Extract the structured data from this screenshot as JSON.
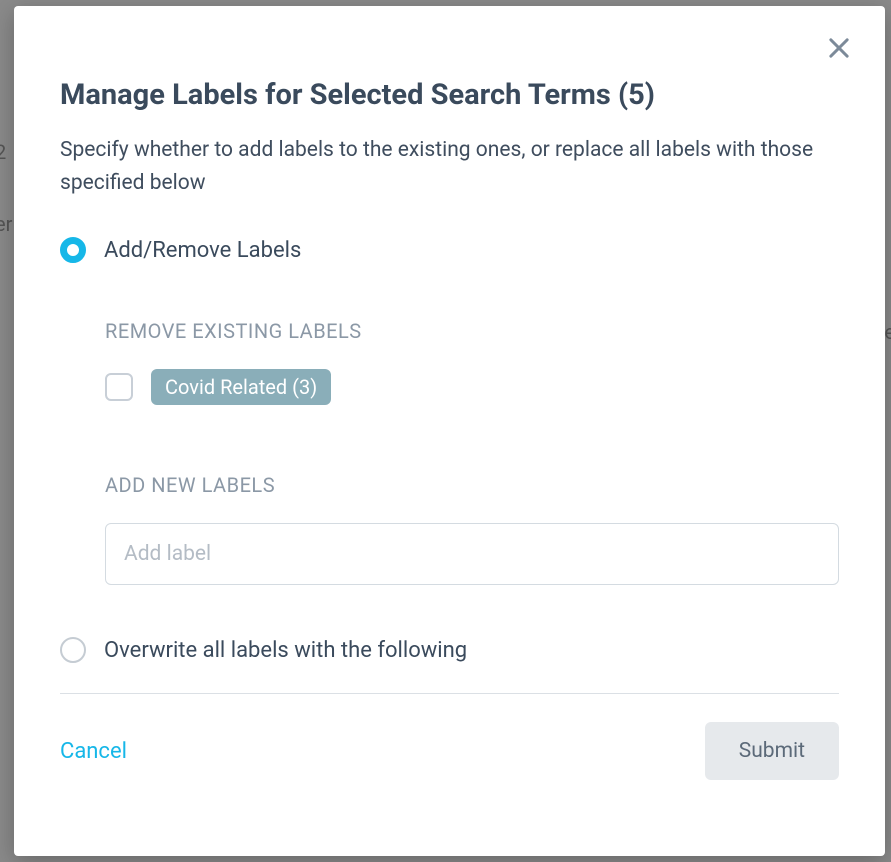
{
  "modal": {
    "title": "Manage Labels for Selected Search Terms (5)",
    "subtitle": "Specify whether to add labels to the existing ones, or replace all labels with those specified below",
    "options": {
      "add_remove": {
        "label": "Add/Remove Labels",
        "selected": true
      },
      "overwrite": {
        "label": "Overwrite all labels with the following",
        "selected": false
      }
    },
    "sections": {
      "remove_heading": "REMOVE EXISTING LABELS",
      "add_heading": "ADD NEW LABELS"
    },
    "existing_labels": [
      {
        "text": "Covid Related (3)",
        "checked": false
      }
    ],
    "add_input": {
      "placeholder": "Add label",
      "value": ""
    },
    "footer": {
      "cancel": "Cancel",
      "submit": "Submit"
    }
  }
}
